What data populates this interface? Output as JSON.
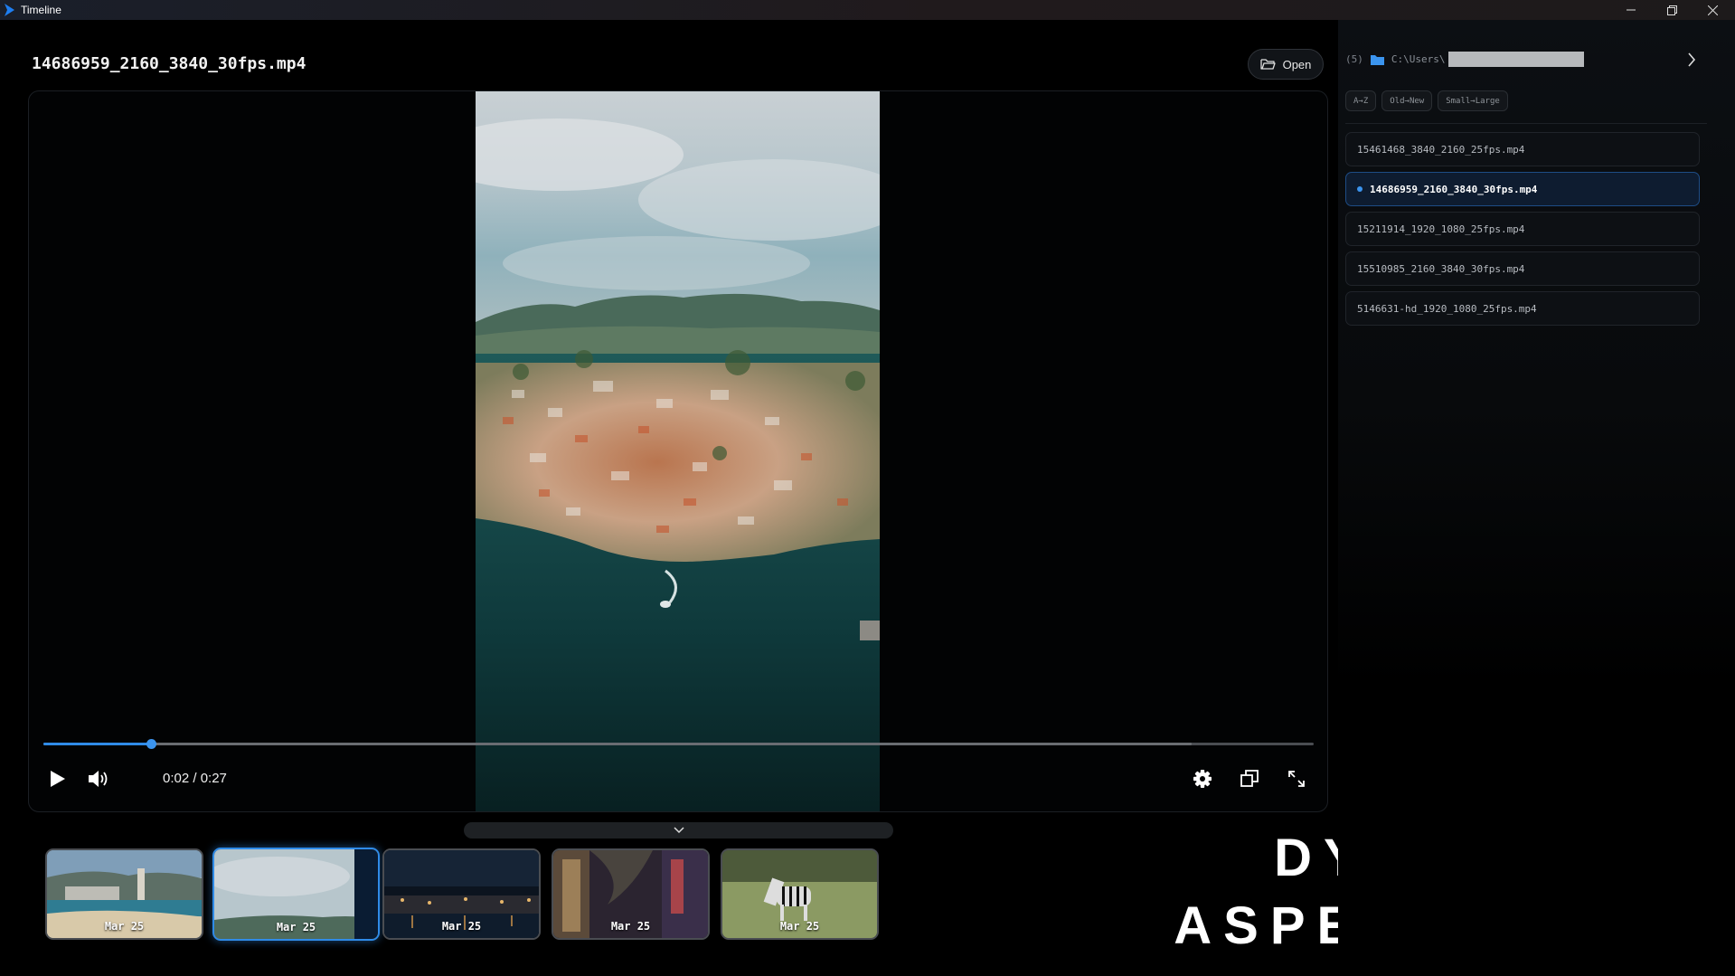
{
  "window": {
    "title": "Timeline",
    "controls": [
      "minimize-icon",
      "restore-icon",
      "close-icon"
    ]
  },
  "player": {
    "file_name": "14686959_2160_3840_30fps.mp4",
    "open_label": "Open",
    "time_display": "0:02 / 0:27",
    "progress_fraction": 0.085,
    "buffered_fraction": 0.904,
    "accent_color": "#2f8be8"
  },
  "thumbnails": [
    {
      "date": "Mar 25",
      "active": false
    },
    {
      "date": "Mar 25",
      "active": true
    },
    {
      "date": "Mar 25",
      "active": false
    },
    {
      "date": "Mar 25",
      "active": false
    },
    {
      "date": "Mar 25",
      "active": false
    }
  ],
  "headline": {
    "line1": "DYNAMIC",
    "line2": "ASPECT RATIO"
  },
  "browser": {
    "count_label": "(5)",
    "path": "C:\\Users\\",
    "sort_options": [
      "A→Z",
      "Old→New",
      "Small→Large"
    ],
    "files": [
      {
        "name": "15461468_3840_2160_25fps.mp4",
        "active": false
      },
      {
        "name": "14686959_2160_3840_30fps.mp4",
        "active": true
      },
      {
        "name": "15211914_1920_1080_25fps.mp4",
        "active": false
      },
      {
        "name": "15510985_2160_3840_30fps.mp4",
        "active": false
      },
      {
        "name": "5146631-hd_1920_1080_25fps.mp4",
        "active": false
      }
    ]
  }
}
